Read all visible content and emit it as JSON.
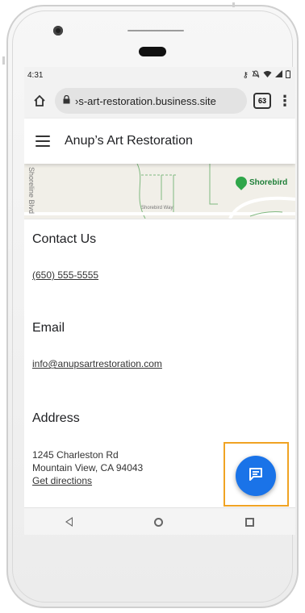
{
  "status_bar": {
    "time": "4:31"
  },
  "browser": {
    "url": "›s-art-restoration.business.site",
    "tab_count": "63"
  },
  "site": {
    "title": "Anup’s Art Restoration"
  },
  "map": {
    "street_vertical": "Shoreline Blvd",
    "street_horizontal": "Shorebird Way",
    "poi_label": "Shorebird"
  },
  "contact": {
    "heading": "Contact Us",
    "phone": "(650) 555-5555",
    "email_heading": "Email",
    "email": "info@anupsartrestoration.com",
    "address_heading": "Address",
    "address_line1": "1245 Charleston Rd",
    "address_line2": "Mountain View, CA 94043",
    "directions": "Get directions"
  },
  "colors": {
    "accent": "#1a73e8",
    "highlight": "#f0a323",
    "poi": "#2fa64a"
  },
  "icons": {
    "fab": "chat-icon",
    "home": "home-icon",
    "lock": "lock-icon",
    "menu": "hamburger-icon"
  }
}
